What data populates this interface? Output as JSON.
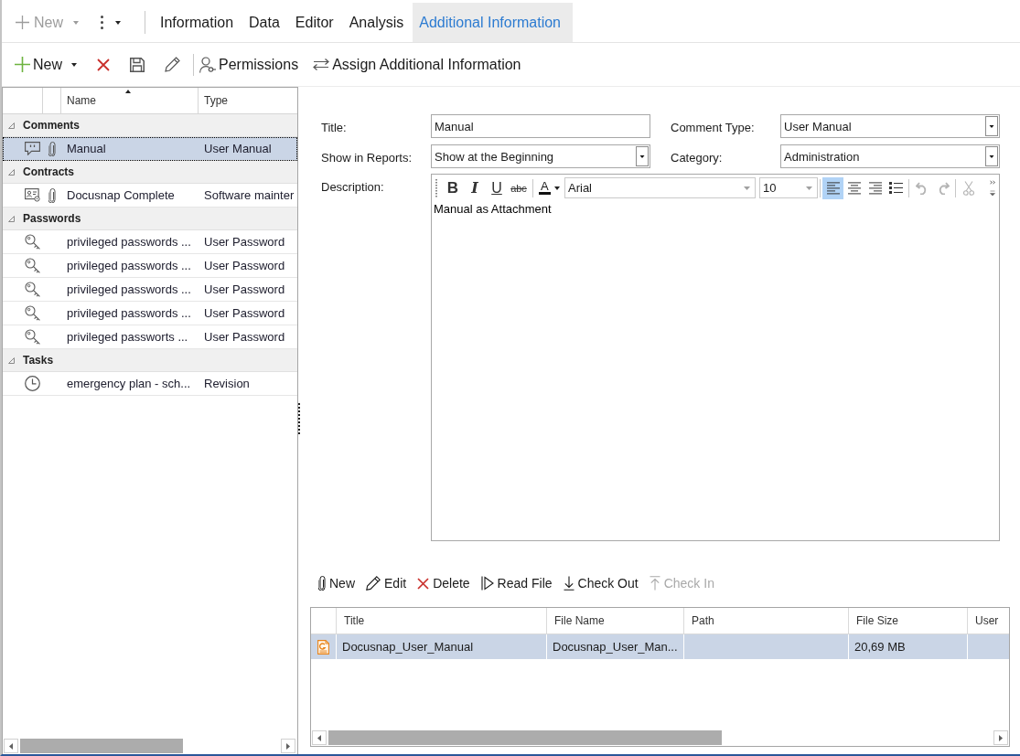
{
  "ribbon": {
    "new_button": {
      "label": "New",
      "disabled": true
    },
    "tabs": [
      {
        "label": "Information",
        "selected": false
      },
      {
        "label": "Data",
        "selected": false
      },
      {
        "label": "Editor",
        "selected": false
      },
      {
        "label": "Analysis",
        "selected": false
      },
      {
        "label": "Additional Information",
        "selected": true
      }
    ]
  },
  "toolbar": {
    "new_label": "New",
    "permissions_label": "Permissions",
    "assign_label": "Assign Additional Information"
  },
  "tree": {
    "columns": [
      {
        "label": "Name",
        "sorted": true
      },
      {
        "label": "Type",
        "sorted": false
      }
    ],
    "groups": [
      {
        "label": "Comments",
        "expanded": true,
        "children": [
          {
            "kind": "comment",
            "attachment": true,
            "name": "Manual",
            "type": "User Manual",
            "selected": true
          }
        ]
      },
      {
        "label": "Contracts",
        "expanded": true,
        "children": [
          {
            "kind": "contract",
            "attachment": true,
            "name": "Docusnap Complete",
            "type": "Software mainter",
            "selected": false
          }
        ]
      },
      {
        "label": "Passwords",
        "expanded": true,
        "children": [
          {
            "kind": "password",
            "attachment": false,
            "name": "privileged passwords ...",
            "type": "User Password",
            "selected": false
          },
          {
            "kind": "password",
            "attachment": false,
            "name": "privileged passwords ...",
            "type": "User Password",
            "selected": false
          },
          {
            "kind": "password",
            "attachment": false,
            "name": "privileged passwords ...",
            "type": "User Password",
            "selected": false
          },
          {
            "kind": "password",
            "attachment": false,
            "name": "privileged passwords ...",
            "type": "User Password",
            "selected": false
          },
          {
            "kind": "password",
            "attachment": false,
            "name": "privileged passworts ...",
            "type": "User Password",
            "selected": false
          }
        ]
      },
      {
        "label": "Tasks",
        "expanded": true,
        "children": [
          {
            "kind": "task",
            "attachment": false,
            "name": "emergency plan - sch...",
            "type": "Revision",
            "selected": false
          }
        ]
      }
    ]
  },
  "form": {
    "fields": [
      {
        "label": "Title:",
        "kind": "text",
        "value": "Manual"
      },
      {
        "label": "Comment Type:",
        "kind": "select",
        "value": "User Manual"
      },
      {
        "label": "Show in Reports:",
        "kind": "select",
        "value": "Show at the Beginning"
      },
      {
        "label": "Category:",
        "kind": "select",
        "value": "Administration"
      }
    ],
    "description": {
      "label": "Description:",
      "format_buttons": [
        {
          "kind": "bold",
          "label": "B"
        },
        {
          "kind": "italic",
          "label": "I"
        },
        {
          "kind": "underline",
          "label": "U"
        },
        {
          "kind": "strikethrough",
          "label": "abc"
        }
      ],
      "color_button_label": "A",
      "combos": [
        {
          "kind": "typeface",
          "value": "Arial"
        },
        {
          "kind": "points",
          "value": "10"
        }
      ],
      "align_buttons": [
        {
          "kind": "left",
          "selected": true
        },
        {
          "kind": "center",
          "selected": false
        },
        {
          "kind": "right",
          "selected": false
        }
      ],
      "history_buttons": [
        {
          "kind": "undo",
          "disabled": true
        },
        {
          "kind": "redo",
          "disabled": true
        }
      ],
      "cut_disabled": true,
      "text": "Manual as Attachment"
    }
  },
  "attachments": {
    "toolbar": [
      {
        "kind": "new",
        "label": "New",
        "disabled": false
      },
      {
        "kind": "edit",
        "label": "Edit",
        "disabled": false
      },
      {
        "kind": "delete",
        "label": "Delete",
        "disabled": false
      },
      {
        "kind": "read",
        "label": "Read File",
        "disabled": false
      },
      {
        "kind": "checkout",
        "label": "Check Out",
        "disabled": false
      },
      {
        "kind": "checkin",
        "label": "Check In",
        "disabled": true
      }
    ],
    "columns": [
      "Title",
      "File Name",
      "Path",
      "File Size",
      "User"
    ],
    "rows": [
      {
        "selected": true,
        "title": "Docusnap_User_Manual",
        "file_name": "Docusnap_User_Man...",
        "file_size": "20,69 MB"
      }
    ]
  }
}
